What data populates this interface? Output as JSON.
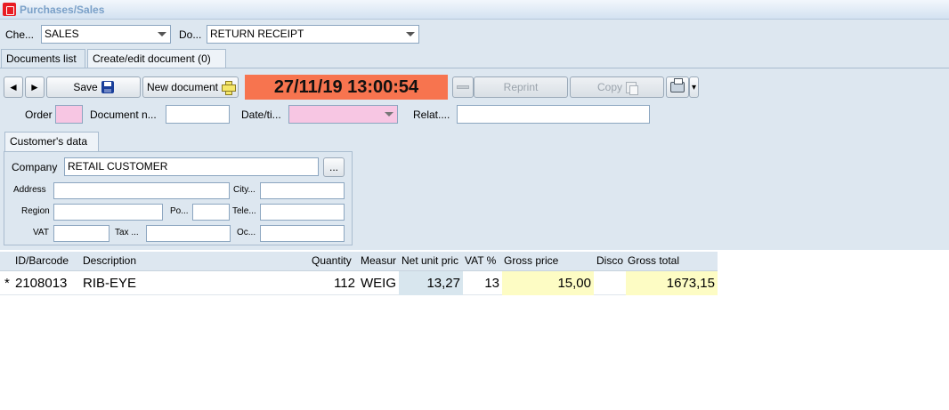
{
  "window": {
    "title": "Purchases/Sales"
  },
  "header": {
    "checkout_label": "Che...",
    "checkout_value": "SALES",
    "doc_type_label": "Do...",
    "doc_type_value": "RETURN RECEIPT"
  },
  "tabs": [
    {
      "label": "Documents list"
    },
    {
      "label": "Create/edit document (0)"
    }
  ],
  "toolbar": {
    "prev_glyph": "◄",
    "next_glyph": "►",
    "save_label": "Save",
    "new_document_label": "New document",
    "datetime": "27/11/19 13:00:54",
    "reprint_label": "Reprint",
    "copy_label": "Copy",
    "print_dropdown_glyph": "▾"
  },
  "document_fields": {
    "order_label": "Order",
    "order_value": "",
    "document_number_label": "Document n...",
    "document_number_value": "",
    "datetime_label": "Date/ti...",
    "datetime_value": "",
    "related_label": "Relat....",
    "related_value": ""
  },
  "customer": {
    "tab_label": "Customer's data",
    "company_label": "Company",
    "company_value": "RETAIL CUSTOMER",
    "browse_label": "...",
    "address_label": "Address",
    "city_label": "City...",
    "region_label": "Region",
    "postcode_label": "Po...",
    "telephone_label": "Tele...",
    "vat_label": "VAT",
    "tax_label": "Tax ...",
    "oc_label": "Oc..."
  },
  "grid": {
    "columns": [
      "ID/Barcode",
      "Description",
      "Quantity",
      "Measur",
      "Net unit pric",
      "VAT %",
      "Gross price",
      "Disco",
      "Gross total"
    ],
    "rows": [
      {
        "marker": "*",
        "id": "2108013",
        "description": "RIB-EYE",
        "quantity": "112",
        "measure": "WEIG",
        "net_unit_price": "13,27",
        "vat": "13",
        "gross_price": "15,00",
        "discount": "",
        "gross_total": "1673,15"
      }
    ]
  },
  "colors": {
    "datetime_bg": "#f7744f",
    "highlight_yellow": "#fdfcc4",
    "highlight_blue": "#d8e6ee",
    "required_pink": "#f7c6e3"
  },
  "icons": {
    "save": "floppy-disk-icon",
    "new": "plus-icon",
    "copy": "copy-icon",
    "print": "printer-icon",
    "app": "app-icon"
  }
}
